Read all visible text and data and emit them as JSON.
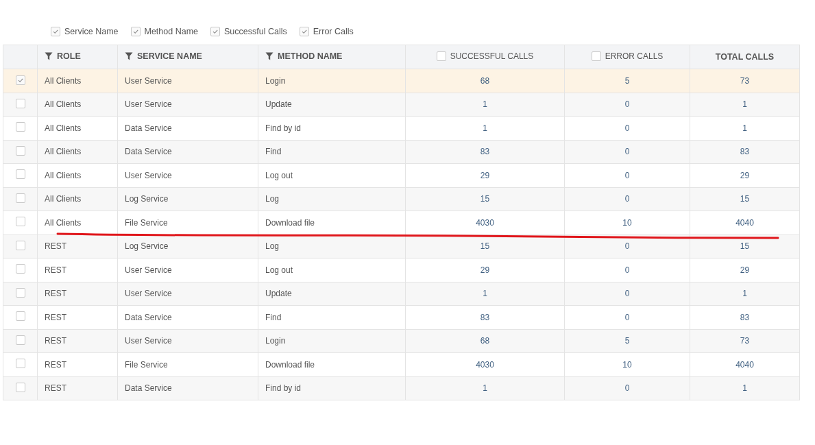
{
  "column_toggles": [
    {
      "label": "Service Name",
      "checked": true
    },
    {
      "label": "Method Name",
      "checked": true
    },
    {
      "label": "Successful Calls",
      "checked": true
    },
    {
      "label": "Error Calls",
      "checked": true
    }
  ],
  "table": {
    "columns": [
      {
        "label": "ROLE",
        "kind": "filter"
      },
      {
        "label": "SERVICE NAME",
        "kind": "filter"
      },
      {
        "label": "METHOD NAME",
        "kind": "filter"
      },
      {
        "label": "SUCCESSFUL CALLS",
        "kind": "checkbox",
        "checked": false
      },
      {
        "label": "ERROR CALLS",
        "kind": "checkbox",
        "checked": false
      },
      {
        "label": "TOTAL CALLS",
        "kind": "plain"
      }
    ],
    "rows": [
      {
        "selected": true,
        "cells": [
          "All Clients",
          "User Service",
          "Login",
          "68",
          "5",
          "73"
        ]
      },
      {
        "selected": false,
        "cells": [
          "All Clients",
          "User Service",
          "Update",
          "1",
          "0",
          "1"
        ]
      },
      {
        "selected": false,
        "cells": [
          "All Clients",
          "Data Service",
          "Find by id",
          "1",
          "0",
          "1"
        ]
      },
      {
        "selected": false,
        "cells": [
          "All Clients",
          "Data Service",
          "Find",
          "83",
          "0",
          "83"
        ]
      },
      {
        "selected": false,
        "cells": [
          "All Clients",
          "User Service",
          "Log out",
          "29",
          "0",
          "29"
        ]
      },
      {
        "selected": false,
        "cells": [
          "All Clients",
          "Log Service",
          "Log",
          "15",
          "0",
          "15"
        ]
      },
      {
        "selected": false,
        "cells": [
          "All Clients",
          "File Service",
          "Download file",
          "4030",
          "10",
          "4040"
        ]
      },
      {
        "selected": false,
        "cells": [
          "REST",
          "Log Service",
          "Log",
          "15",
          "0",
          "15"
        ]
      },
      {
        "selected": false,
        "cells": [
          "REST",
          "User Service",
          "Log out",
          "29",
          "0",
          "29"
        ]
      },
      {
        "selected": false,
        "cells": [
          "REST",
          "User Service",
          "Update",
          "1",
          "0",
          "1"
        ]
      },
      {
        "selected": false,
        "cells": [
          "REST",
          "Data Service",
          "Find",
          "83",
          "0",
          "83"
        ]
      },
      {
        "selected": false,
        "cells": [
          "REST",
          "User Service",
          "Login",
          "68",
          "5",
          "73"
        ]
      },
      {
        "selected": false,
        "cells": [
          "REST",
          "File Service",
          "Download file",
          "4030",
          "10",
          "4040"
        ]
      },
      {
        "selected": false,
        "cells": [
          "REST",
          "Data Service",
          "Find by id",
          "1",
          "0",
          "1"
        ]
      }
    ]
  }
}
